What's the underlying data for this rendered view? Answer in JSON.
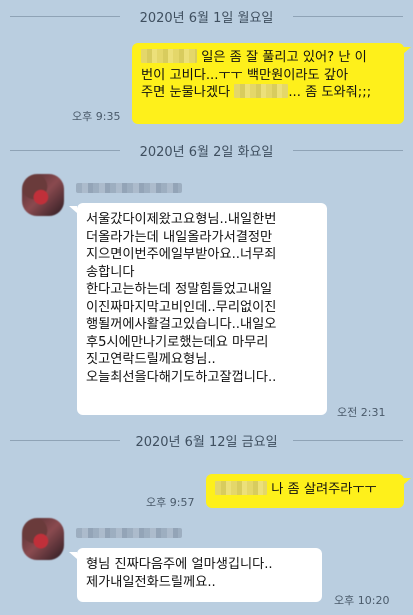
{
  "dividers": [
    {
      "label": "2020년 6월 1일 월요일"
    },
    {
      "label": "2020년 6월 2일 화요일"
    },
    {
      "label": "2020년 6월 12일 금요일"
    }
  ],
  "messages": [
    {
      "direction": "outgoing",
      "lines_after_redaction": " 일은 좀 잘 풀리고 있어? 난 이",
      "line2": "번이 고비다...ㅜㅜ 백만원이라도 갚아",
      "line3_before_redaction": "주면 눈물나겠다 ",
      "line3_after_redaction": "... 좀 도와줘;;;",
      "time": "오후 9:35"
    },
    {
      "direction": "incoming",
      "lines": [
        "서울갔다이제왔고요형님..내일한번",
        "더올라가는데 내일올라가서결정만",
        "지으면이번주에일부받아요..너무죄",
        "송합니다",
        "한다고는하는데 정말힘들었고내일",
        "이진짜마지막고비인데..무리없이진",
        "행될꺼에사활걸고있습니다..내일오",
        "후5시에만나기로했는데요 마무리",
        "짓고연락드릴께요형님..",
        "오늘최선을다해기도하고잘껍니다.."
      ],
      "time": "오전 2:31"
    },
    {
      "direction": "outgoing",
      "text_after_redaction": " 나 좀 살려주라ㅜㅜ",
      "time": "오후 9:57"
    },
    {
      "direction": "incoming",
      "lines": [
        "형님 진짜다음주에 얼마생깁니다..",
        "제가내일전화드릴께요.."
      ],
      "time": "오후 10:20"
    }
  ],
  "colors": {
    "background": "#bacee0",
    "outgoing_bubble": "#fef01b",
    "incoming_bubble": "#ffffff"
  }
}
